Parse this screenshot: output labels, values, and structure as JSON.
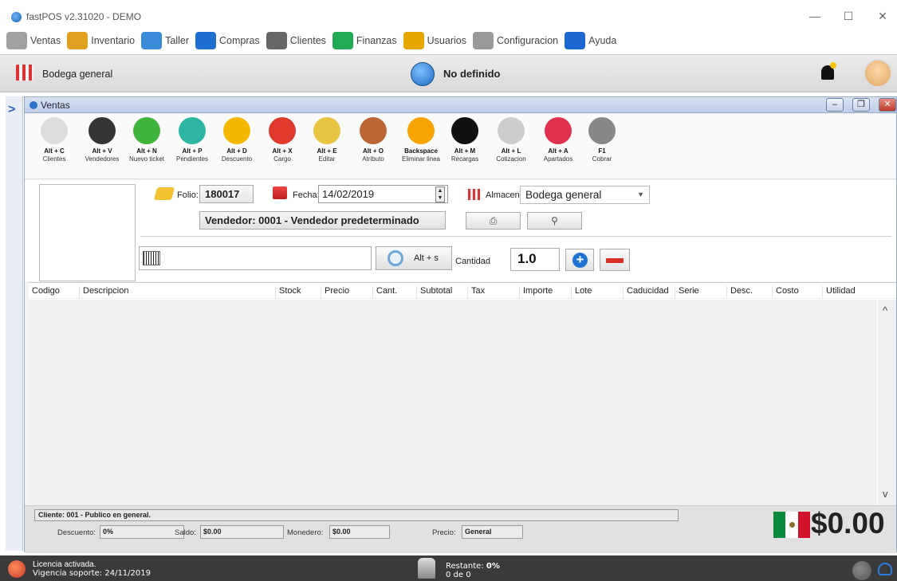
{
  "window": {
    "title": "fastPOS v2.31020 - DEMO",
    "minimize": "—",
    "maximize": "☐",
    "close": "✕"
  },
  "menu": [
    {
      "label": "Ventas",
      "icon": "cart-icon",
      "color": "#a0a0a0"
    },
    {
      "label": "Inventario",
      "icon": "sandwich-icon",
      "color": "#e0a020"
    },
    {
      "label": "Taller",
      "icon": "tools-icon",
      "color": "#3b8ad8"
    },
    {
      "label": "Compras",
      "icon": "basket-icon",
      "color": "#1e6fd0"
    },
    {
      "label": "Clientes",
      "icon": "person-icon",
      "color": "#666"
    },
    {
      "label": "Finanzas",
      "icon": "calculator-icon",
      "color": "#2a5"
    },
    {
      "label": "Usuarios",
      "icon": "users-icon",
      "color": "#e6a700"
    },
    {
      "label": "Configuracion",
      "icon": "gear-icon",
      "color": "#999"
    },
    {
      "label": "Ayuda",
      "icon": "help-icon",
      "color": "#1f67d0"
    }
  ],
  "header": {
    "store_name": "Bodega general",
    "status": "No definido"
  },
  "ventas_window": {
    "title": "Ventas",
    "min": "–",
    "restore": "❐",
    "close": "✕"
  },
  "toolbar": [
    {
      "key": "Alt + C",
      "label": "Clientes",
      "icon": "client-icon",
      "color": "#ddd"
    },
    {
      "key": "Alt + V",
      "label": "Vendedores",
      "icon": "seller-icon",
      "color": "#333"
    },
    {
      "key": "Alt + N",
      "label": "Nuevo ticket",
      "icon": "green-circle-icon",
      "color": "#3fb43c"
    },
    {
      "key": "Alt + P",
      "label": "Pendientes",
      "icon": "hourglass-icon",
      "color": "#2eb5a2"
    },
    {
      "key": "Alt + D",
      "label": "Descuento",
      "icon": "minus-circle-icon",
      "color": "#f5b800"
    },
    {
      "key": "Alt + X",
      "label": "Cargo",
      "icon": "plus-circle-icon",
      "color": "#e03a2e"
    },
    {
      "key": "Alt + E",
      "label": "Editar",
      "icon": "pencil-icon",
      "color": "#e8c542"
    },
    {
      "key": "Alt + O",
      "label": "Atributo",
      "icon": "crayons-icon",
      "color": "#b63"
    },
    {
      "key": "Backspace",
      "label": "Eliminar linea",
      "icon": "orange-circle-icon",
      "color": "#f7a400"
    },
    {
      "key": "Alt + M",
      "label": "Recargas",
      "icon": "phone-icon",
      "color": "#111"
    },
    {
      "key": "Alt + L",
      "label": "Cotizacion",
      "icon": "receipt-icon",
      "color": "#ccc"
    },
    {
      "key": "Alt + A",
      "label": "Apartados",
      "icon": "gift-icon",
      "color": "#e0314f"
    },
    {
      "key": "F1",
      "label": "Cobrar",
      "icon": "money-bag-icon",
      "color": "#888"
    }
  ],
  "form": {
    "folio_label": "Folio:",
    "folio_value": "180017",
    "fecha_label": "Fecha:",
    "fecha_value": "14/02/2019",
    "almacen_label": "Almacen:",
    "almacen_value": "Bodega general",
    "vendedor": "Vendedor: 0001 - Vendedor predeterminado",
    "print_icon": "⎙",
    "search_customer_icon": "⚲",
    "search_shortcut": "Alt + s",
    "cantidad_label": "Cantidad",
    "cantidad_value": "1.0"
  },
  "table": {
    "columns": [
      "Codigo",
      "Descripcion",
      "Stock",
      "Precio",
      "Cant.",
      "Subtotal",
      "Tax",
      "Importe",
      "Lote",
      "Caducidad",
      "Serie",
      "Desc.",
      "Costo",
      "Utilidad"
    ],
    "rows": []
  },
  "footer": {
    "cliente": "Cliente: 001 - Publico en general.",
    "descuento_label": "Descuento:",
    "descuento_value": "0%",
    "saldo_label": "Saldo:",
    "saldo_value": "$0.00",
    "monedero_label": "Monedero:",
    "monedero_value": "$0.00",
    "precio_label": "Precio:",
    "precio_value": "General",
    "total": "$0.00"
  },
  "statusbar": {
    "license": "Licencia activada.",
    "support": "Vigencia soporte: 24/11/2019",
    "remaining_label": "Restante:",
    "remaining_value": "0%",
    "remaining_count": "0 de 0"
  }
}
